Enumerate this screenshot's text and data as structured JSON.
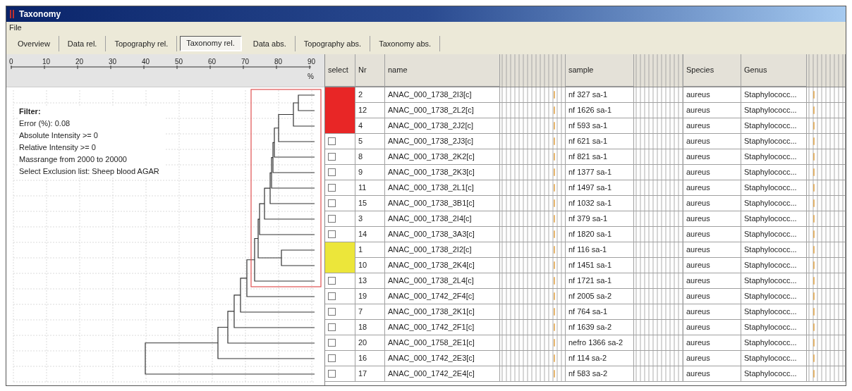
{
  "window": {
    "title": "Taxonomy"
  },
  "menu": [
    "File"
  ],
  "tabs": [
    {
      "label": "Overview",
      "selected": false
    },
    {
      "label": "Data rel.",
      "selected": false
    },
    {
      "label": "Topography rel.",
      "selected": false
    },
    {
      "label": "Taxonomy rel.",
      "selected": true
    },
    {
      "label": "Data abs.",
      "selected": false
    },
    {
      "label": "Topography abs.",
      "selected": false
    },
    {
      "label": "Taxonomy abs.",
      "selected": false
    }
  ],
  "scale": {
    "ticks": [
      "0",
      "10",
      "20",
      "30",
      "40",
      "50",
      "60",
      "70",
      "80",
      "90"
    ],
    "unit": "%"
  },
  "filter": {
    "title": "Filter:",
    "lines": [
      "Error (%): 0.08",
      "Absolute Intensity >= 0",
      "Relative Intensity >= 0",
      "Massrange from 2000 to 20000",
      "Select Exclusion list: Sheep blood AGAR"
    ]
  },
  "table": {
    "columns": [
      "select",
      "Nr",
      "name",
      "sample",
      "Species",
      "Genus"
    ],
    "rows": [
      {
        "kind": "group",
        "color": "#e82626",
        "nr": "2",
        "name": "ANAC_000_1738_2I3[c]",
        "sample": "nf 327 sa-1",
        "species": "aureus",
        "genus": "Staphylococc..."
      },
      {
        "kind": "group",
        "color": "#e82626",
        "nr": "12",
        "name": "ANAC_000_1738_2L2[c]",
        "sample": "nf 1626 sa-1",
        "species": "aureus",
        "genus": "Staphylococc..."
      },
      {
        "kind": "group",
        "color": "#e82626",
        "nr": "4",
        "name": "ANAC_000_1738_2J2[c]",
        "sample": "nf 593 sa-1",
        "species": "aureus",
        "genus": "Staphylococc..."
      },
      {
        "kind": "checkbox",
        "checked": false,
        "nr": "5",
        "name": "ANAC_000_1738_2J3[c]",
        "sample": "nf 621 sa-1",
        "species": "aureus",
        "genus": "Staphylococc..."
      },
      {
        "kind": "checkbox",
        "checked": false,
        "nr": "8",
        "name": "ANAC_000_1738_2K2[c]",
        "sample": "nf 821 sa-1",
        "species": "aureus",
        "genus": "Staphylococc..."
      },
      {
        "kind": "checkbox",
        "checked": false,
        "nr": "9",
        "name": "ANAC_000_1738_2K3[c]",
        "sample": "nf 1377 sa-1",
        "species": "aureus",
        "genus": "Staphylococc..."
      },
      {
        "kind": "checkbox",
        "checked": false,
        "nr": "11",
        "name": "ANAC_000_1738_2L1[c]",
        "sample": "nf 1497 sa-1",
        "species": "aureus",
        "genus": "Staphylococc..."
      },
      {
        "kind": "checkbox",
        "checked": false,
        "nr": "15",
        "name": "ANAC_000_1738_3B1[c]",
        "sample": "nf 1032 sa-1",
        "species": "aureus",
        "genus": "Staphylococc..."
      },
      {
        "kind": "checkbox",
        "checked": false,
        "nr": "3",
        "name": "ANAC_000_1738_2I4[c]",
        "sample": "nf 379 sa-1",
        "species": "aureus",
        "genus": "Staphylococc..."
      },
      {
        "kind": "checkbox",
        "checked": false,
        "nr": "14",
        "name": "ANAC_000_1738_3A3[c]",
        "sample": "nf 1820 sa-1",
        "species": "aureus",
        "genus": "Staphylococc..."
      },
      {
        "kind": "group",
        "color": "#ece63a",
        "nr": "1",
        "name": "ANAC_000_1738_2I2[c]",
        "sample": "nf 116 sa-1",
        "species": "aureus",
        "genus": "Staphylococc..."
      },
      {
        "kind": "group",
        "color": "#ece63a",
        "nr": "10",
        "name": "ANAC_000_1738_2K4[c]",
        "sample": "nf 1451 sa-1",
        "species": "aureus",
        "genus": "Staphylococc..."
      },
      {
        "kind": "checkbox",
        "checked": false,
        "nr": "13",
        "name": "ANAC_000_1738_2L4[c]",
        "sample": "nf 1721 sa-1",
        "species": "aureus",
        "genus": "Staphylococc..."
      },
      {
        "kind": "checkbox",
        "checked": false,
        "nr": "19",
        "name": "ANAC_000_1742_2F4[c]",
        "sample": "nf 2005 sa-2",
        "species": "aureus",
        "genus": "Staphylococc..."
      },
      {
        "kind": "checkbox",
        "checked": false,
        "nr": "7",
        "name": "ANAC_000_1738_2K1[c]",
        "sample": "nf 764 sa-1",
        "species": "aureus",
        "genus": "Staphylococc..."
      },
      {
        "kind": "checkbox",
        "checked": false,
        "nr": "18",
        "name": "ANAC_000_1742_2F1[c]",
        "sample": "nf 1639 sa-2",
        "species": "aureus",
        "genus": "Staphylococc..."
      },
      {
        "kind": "checkbox",
        "checked": false,
        "nr": "20",
        "name": "ANAC_000_1758_2E1[c]",
        "sample": "nefro 1366 sa-2",
        "species": "aureus",
        "genus": "Staphylococc..."
      },
      {
        "kind": "checkbox",
        "checked": false,
        "nr": "16",
        "name": "ANAC_000_1742_2E3[c]",
        "sample": "nf 114 sa-2",
        "species": "aureus",
        "genus": "Staphylococc..."
      },
      {
        "kind": "checkbox",
        "checked": false,
        "nr": "17",
        "name": "ANAC_000_1742_2E4[c]",
        "sample": "nf 583 sa-2",
        "species": "aureus",
        "genus": "Staphylococc..."
      }
    ]
  }
}
